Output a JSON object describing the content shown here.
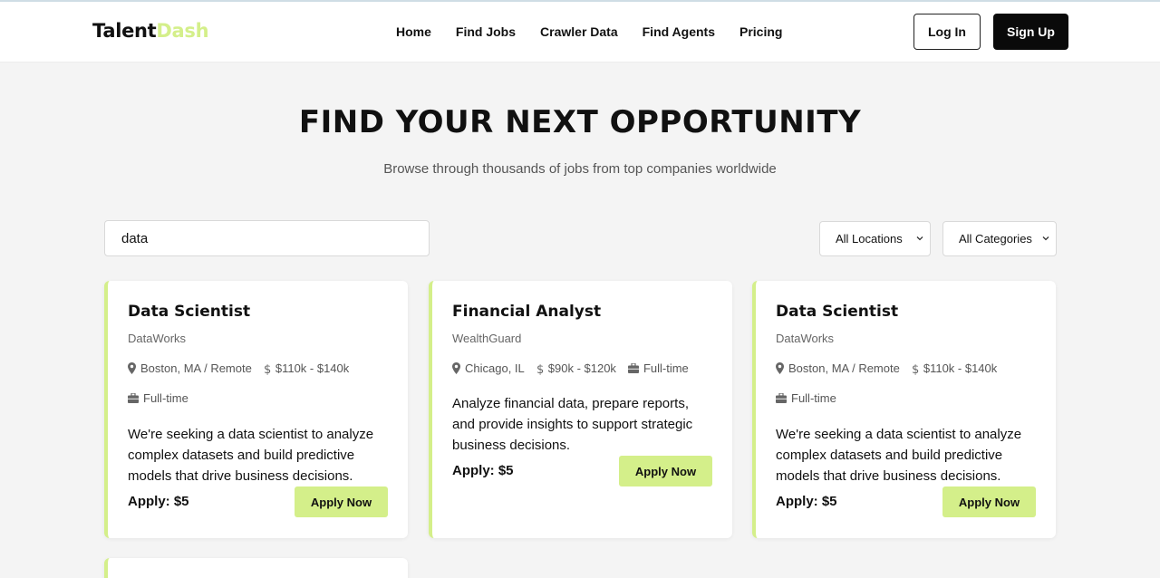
{
  "brand": {
    "part1": "Talent",
    "part2": "Dash",
    "accent": "#d4ef8a"
  },
  "nav": {
    "items": [
      {
        "label": "Home"
      },
      {
        "label": "Find Jobs"
      },
      {
        "label": "Crawler Data"
      },
      {
        "label": "Find Agents"
      },
      {
        "label": "Pricing"
      }
    ]
  },
  "auth": {
    "login": "Log In",
    "signup": "Sign Up"
  },
  "hero": {
    "title": "FIND YOUR NEXT OPPORTUNITY",
    "subtitle": "Browse through thousands of jobs from top companies worldwide"
  },
  "filters": {
    "search_value": "data",
    "location": "All Locations",
    "category": "All Categories"
  },
  "jobs": [
    {
      "title": "Data Scientist",
      "company": "DataWorks",
      "location": "Boston, MA / Remote",
      "salary": "$110k - $140k",
      "type": "Full-time",
      "description": "We're seeking a data scientist to analyze complex datasets and build predictive models that drive business decisions.",
      "price": "Apply: $5",
      "apply_label": "Apply Now"
    },
    {
      "title": "Financial Analyst",
      "company": "WealthGuard",
      "location": "Chicago, IL",
      "salary": "$90k - $120k",
      "type": "Full-time",
      "description": "Analyze financial data, prepare reports, and provide insights to support strategic business decisions.",
      "price": "Apply: $5",
      "apply_label": "Apply Now"
    },
    {
      "title": "Data Scientist",
      "company": "DataWorks",
      "location": "Boston, MA / Remote",
      "salary": "$110k - $140k",
      "type": "Full-time",
      "description": "We're seeking a data scientist to analyze complex datasets and build predictive models that drive business decisions.",
      "price": "Apply: $5",
      "apply_label": "Apply Now"
    }
  ]
}
